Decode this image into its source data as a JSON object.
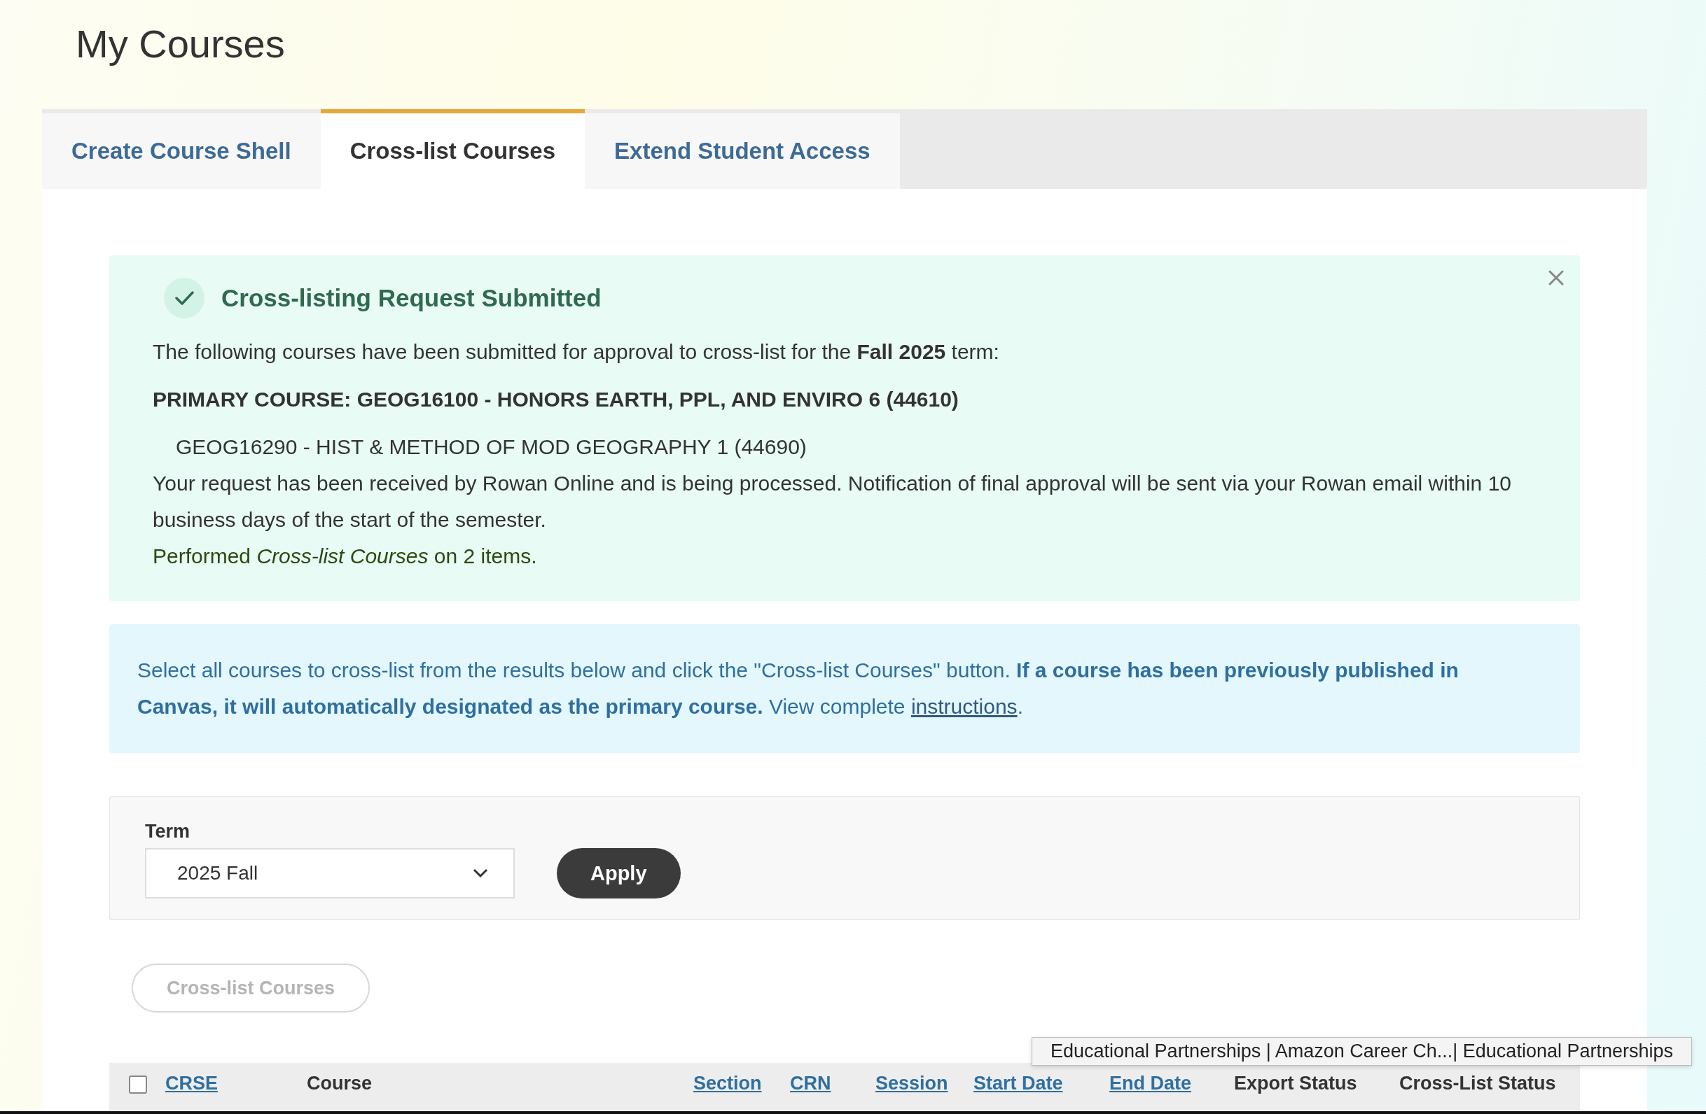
{
  "page": {
    "title": "My Courses"
  },
  "tabs": [
    {
      "label": "Create Course Shell",
      "selected": false
    },
    {
      "label": "Cross-list Courses",
      "selected": true
    },
    {
      "label": "Extend Student Access",
      "selected": false
    }
  ],
  "success_alert": {
    "title": "Cross-listing Request Submitted",
    "intro": "The following courses have been submitted for approval to cross-list for the **Fall 2025** term:",
    "primary_course": "PRIMARY COURSE: GEOG16100 - HONORS EARTH, PPL, AND ENVIRO 6 (44610)",
    "secondary_courses": [
      "GEOG16290 - HIST & METHOD OF MOD GEOGRAPHY 1 (44690)"
    ],
    "message": "Your request has been received by Rowan Online and is being processed. Notification of final approval will be sent via your Rowan email within 10 business days of the start of the semester.",
    "result": "Performed *Cross-list Courses* on 2 items."
  },
  "info_alert": {
    "text": "Select all courses to cross-list from the results below and click the \"Cross-list Courses\" button. **If a course has been previously published in Canvas, it will automatically designated as the primary course.** View complete",
    "link": "instructions",
    "after_link": "."
  },
  "filter": {
    "label": "Term",
    "value": "2025 Fall",
    "button": "Apply"
  },
  "cross_list_button": {
    "label": "Cross-list Courses",
    "disabled": true
  },
  "table": {
    "select_all_checked": false,
    "columns": [
      {
        "label": "CRSE",
        "sortable": true
      },
      {
        "label": "Course",
        "sortable": false
      },
      {
        "label": "Section",
        "sortable": true
      },
      {
        "label": "CRN",
        "sortable": true
      },
      {
        "label": "Session",
        "sortable": true
      },
      {
        "label": "Start Date",
        "sortable": true
      },
      {
        "label": "End Date",
        "sortable": true
      },
      {
        "label": "Export Status",
        "sortable": false
      },
      {
        "label": "Cross-List Status",
        "sortable": false
      }
    ]
  },
  "tooltip": "Educational Partnerships | Amazon Career Ch...| Educational Partnerships"
}
